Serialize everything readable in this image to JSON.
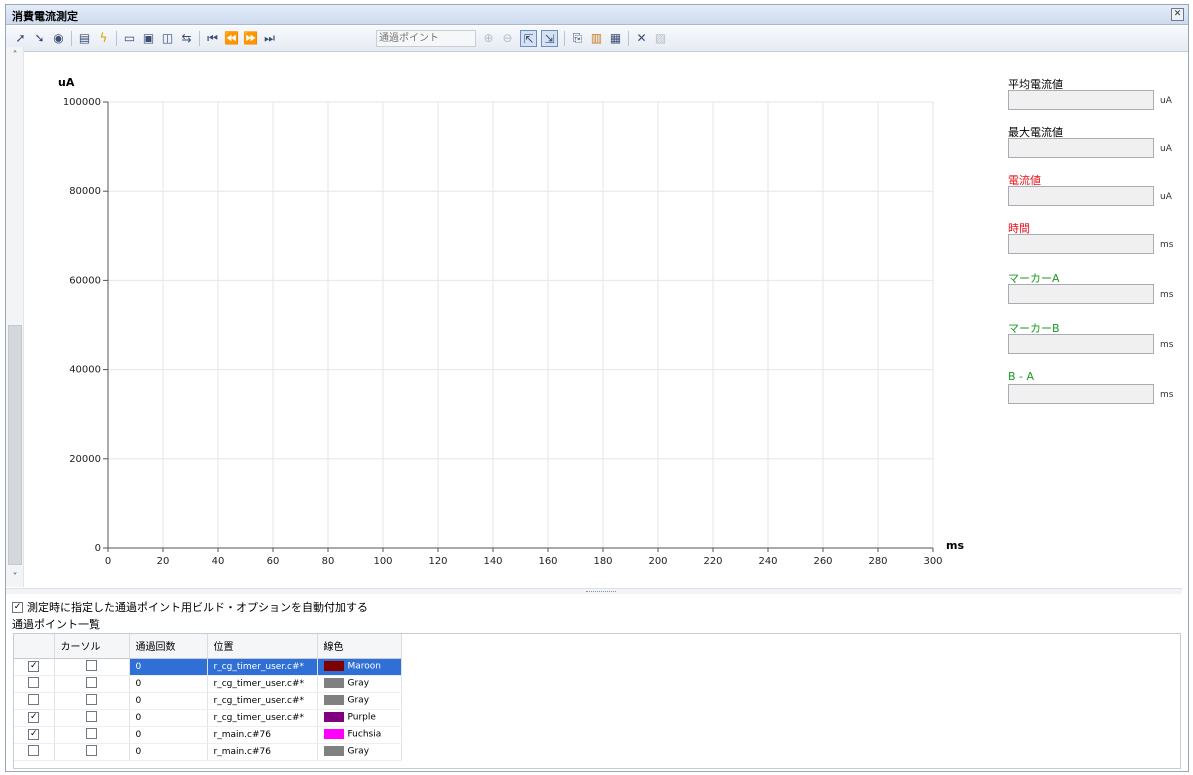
{
  "window": {
    "title": "消費電流測定",
    "close_glyph": "✕"
  },
  "toolbar": {
    "icons": [
      "run-icon",
      "stop-icon",
      "record-icon",
      "settings-icon",
      "trigger-icon",
      "view1-icon",
      "view2-icon",
      "view3-icon",
      "link-icon",
      "first-icon",
      "prev-icon",
      "next-icon",
      "last-icon",
      "zoom-in-icon",
      "zoom-out-icon",
      "pointer-icon",
      "cursor-icon",
      "copy-icon",
      "save-icon",
      "print-icon",
      "clear-icon",
      "export-icon"
    ],
    "pass_point_placeholder": "通過ポイント"
  },
  "chart": {
    "y_unit": "uA",
    "x_unit": "ms"
  },
  "chart_data": {
    "type": "line",
    "xlabel": "ms",
    "ylabel": "uA",
    "xlim": [
      0,
      300
    ],
    "ylim": [
      0,
      100000
    ],
    "x_ticks": [
      0,
      20,
      40,
      60,
      80,
      100,
      120,
      140,
      160,
      180,
      200,
      220,
      240,
      260,
      280,
      300
    ],
    "y_ticks": [
      0,
      20000,
      40000,
      60000,
      80000,
      100000
    ],
    "grid": true,
    "series": []
  },
  "right_panel": {
    "avg_current": {
      "label": "平均電流値",
      "value": "",
      "unit": "uA"
    },
    "max_current": {
      "label": "最大電流値",
      "value": "",
      "unit": "uA"
    },
    "current": {
      "label": "電流値",
      "value": "",
      "unit": "uA"
    },
    "time": {
      "label": "時間",
      "value": "",
      "unit": "ms"
    },
    "marker_a": {
      "label": "マーカーA",
      "value": "",
      "unit": "ms"
    },
    "marker_b": {
      "label": "マーカーB",
      "value": "",
      "unit": "ms"
    },
    "b_minus_a": {
      "label": "B - A",
      "value": "",
      "unit": "ms"
    }
  },
  "options": {
    "auto_add_label": "測定時に指定した通過ポイント用ビルド・オプションを自動付加する",
    "auto_add_checked": true
  },
  "pass_points": {
    "title": "通過ポイント一覧",
    "columns": [
      "",
      "カーソル",
      "通過回数",
      "位置",
      "線色"
    ],
    "rows": [
      {
        "enabled": true,
        "cursor": false,
        "count": "0",
        "position": "r_cg_timer_user.c#*",
        "color_name": "Maroon",
        "color": "#800000",
        "selected": true
      },
      {
        "enabled": false,
        "cursor": false,
        "count": "0",
        "position": "r_cg_timer_user.c#*",
        "color_name": "Gray",
        "color": "#808080",
        "selected": false
      },
      {
        "enabled": false,
        "cursor": false,
        "count": "0",
        "position": "r_cg_timer_user.c#*",
        "color_name": "Gray",
        "color": "#808080",
        "selected": false
      },
      {
        "enabled": true,
        "cursor": false,
        "count": "0",
        "position": "r_cg_timer_user.c#*",
        "color_name": "Purple",
        "color": "#800080",
        "selected": false
      },
      {
        "enabled": true,
        "cursor": false,
        "count": "0",
        "position": "r_main.c#76",
        "color_name": "Fuchsia",
        "color": "#ff00ff",
        "selected": false
      },
      {
        "enabled": false,
        "cursor": false,
        "count": "0",
        "position": "r_main.c#76",
        "color_name": "Gray",
        "color": "#808080",
        "selected": false
      }
    ]
  }
}
